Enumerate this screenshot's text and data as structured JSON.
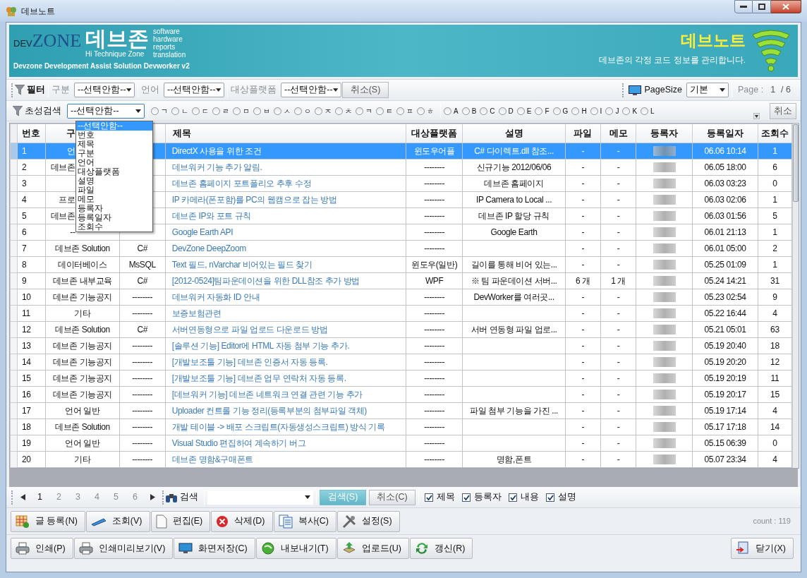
{
  "window": {
    "title": "데브노트"
  },
  "banner": {
    "logo_dev": "DEV",
    "logo_zone": "ZONE",
    "logo_name": "데브존",
    "logo_tagline": "Hi Technique Zone",
    "logo_words": [
      "software",
      "hardware",
      "reports",
      "translation"
    ],
    "subtitle": "Devzone Development Assist Solution Devworker v2",
    "title": "데브노트",
    "description": "데브존의 각정 코드 정보를 관리합니다."
  },
  "filter_bar": {
    "label": "필터",
    "filters": [
      {
        "label": "구분",
        "value": "--선택안함--"
      },
      {
        "label": "언어",
        "value": "--선택안함--"
      },
      {
        "label": "대상플랫폼",
        "value": "--선택안함--"
      }
    ],
    "cancel": "취소(S)",
    "page_size_label": "PageSize",
    "page_size": "기본",
    "page_label": "Page :",
    "page": "1",
    "page_total": "/ 6"
  },
  "initial_bar": {
    "label": "초성검색",
    "value": "--선택안함--",
    "letters": [
      {
        "label": "ㄱ",
        "selected": false
      },
      {
        "label": "ㄴ",
        "selected": false
      },
      {
        "label": "ㄷ",
        "selected": false
      },
      {
        "label": "ㄹ",
        "selected": false
      },
      {
        "label": "ㅁ",
        "selected": false
      },
      {
        "label": "ㅂ",
        "selected": false
      },
      {
        "label": "ㅅ",
        "selected": false
      },
      {
        "label": "ㅇ",
        "selected": false
      },
      {
        "label": "ㅈ",
        "selected": false
      },
      {
        "label": "ㅊ",
        "selected": false
      },
      {
        "label": "ㅋ",
        "selected": false
      },
      {
        "label": "ㅌ",
        "selected": false
      },
      {
        "label": "ㅍ",
        "selected": false
      },
      {
        "label": "ㅎ",
        "selected": false
      }
    ],
    "latin_letters": [
      {
        "label": "A",
        "selected": false
      },
      {
        "label": "B",
        "selected": false
      },
      {
        "label": "C",
        "selected": false
      },
      {
        "label": "D",
        "selected": false
      },
      {
        "label": "E",
        "selected": false
      },
      {
        "label": "F",
        "selected": false
      },
      {
        "label": "G",
        "selected": false
      },
      {
        "label": "H",
        "selected": false
      },
      {
        "label": "I",
        "selected": false
      },
      {
        "label": "J",
        "selected": false
      },
      {
        "label": "K",
        "selected": false
      },
      {
        "label": "L",
        "selected": false
      }
    ],
    "cancel": "취소"
  },
  "dropdown": {
    "open": true,
    "items": [
      {
        "label": "--선택안함--",
        "selected": true
      },
      {
        "label": "번호",
        "selected": false
      },
      {
        "label": "제목",
        "selected": false
      },
      {
        "label": "구분",
        "selected": false
      },
      {
        "label": "언어",
        "selected": false
      },
      {
        "label": "대상플랫폼",
        "selected": false
      },
      {
        "label": "설명",
        "selected": false
      },
      {
        "label": "파일",
        "selected": false
      },
      {
        "label": "메모",
        "selected": false
      },
      {
        "label": "등록자",
        "selected": false
      },
      {
        "label": "등록일자",
        "selected": false
      },
      {
        "label": "조회수",
        "selected": false
      }
    ]
  },
  "table": {
    "headers": {
      "no": "번호",
      "category": "구",
      "title": "제목",
      "platform": "대상플랫폼",
      "description": "설명",
      "file": "파일",
      "memo": "메모",
      "author": "등록자",
      "date": "등록일자",
      "views": "조회수"
    },
    "rows": [
      {
        "no": "1",
        "category": "언",
        "covered": true,
        "title": "DirectX 사용을 위한 조건",
        "platform": "윈도우어플",
        "description": "C# 다이렉트.dll 참조...",
        "file": "-",
        "memo": "-",
        "date": "06.06 10:14",
        "views": "1",
        "selected": true
      },
      {
        "no": "2",
        "category": "데브존",
        "covered": true,
        "title": "데브워커 기능 추가 알림.",
        "platform": "--------",
        "description": "신규기능 2012/06/06",
        "file": "-",
        "memo": "-",
        "date": "06.05 18:00",
        "views": "6",
        "selected": false
      },
      {
        "no": "3",
        "covered": true,
        "title": "데브존 홈페이지 포트폴리오 추후 수정",
        "platform": "--------",
        "description": "데브존 홈페이지",
        "file": "-",
        "memo": "-",
        "date": "06.03 03:23",
        "views": "0",
        "selected": false
      },
      {
        "no": "4",
        "category": "프로",
        "covered": true,
        "title": "IP 카메라(폰포함)를 PC의 웹캠으로 잡는 방법",
        "platform": "--------",
        "description": "IP Camera to Local ...",
        "file": "-",
        "memo": "-",
        "date": "06.03 02:06",
        "views": "1",
        "selected": false
      },
      {
        "no": "5",
        "category": "데브존",
        "covered": true,
        "title": "데브존 IP와 포트 규칙",
        "platform": "--------",
        "description": "데브존 IP 할당 규칙",
        "file": "-",
        "memo": "-",
        "date": "06.03 01:56",
        "views": "5",
        "selected": false
      },
      {
        "no": "6",
        "category": "--",
        "covered": true,
        "title": "Google Earth API",
        "platform": "--------",
        "description": "Google Earth",
        "file": "-",
        "memo": "-",
        "date": "06.01 21:13",
        "views": "1",
        "selected": false
      },
      {
        "no": "7",
        "category": "데브존 Solution",
        "language": "C#",
        "title": "DevZone DeepZoom",
        "platform": "--------",
        "file": "-",
        "memo": "-",
        "date": "06.01 05:00",
        "views": "2",
        "selected": false
      },
      {
        "no": "8",
        "category": "데이터베이스",
        "language": "MsSQL",
        "title": "Text 필드, nVarchar 비어있는 필드 찾기",
        "platform": "윈도우(일반)",
        "description": "길이를 통해 비어 있는...",
        "file": "-",
        "memo": "-",
        "date": "05.25 01:09",
        "views": "1",
        "selected": false
      },
      {
        "no": "9",
        "category": "데브존 내부교육",
        "language": "C#",
        "title": "[2012-0524]팀파운데이션을 위한 DLL참조 추가 방법",
        "platform": "WPF",
        "description": "※ 팀 파운데이션 서버...",
        "file": "6 개",
        "memo": "1 개",
        "date": "05.24 14:21",
        "views": "31",
        "selected": false
      },
      {
        "no": "10",
        "category": "데브존 기능공지",
        "language": "--------",
        "title": "데브워커 자동화 ID 안내",
        "platform": "--------",
        "description": "DevWorker를 여러곳...",
        "file": "-",
        "memo": "-",
        "date": "05.23 02:54",
        "views": "9",
        "selected": false
      },
      {
        "no": "11",
        "category": "기타",
        "language": "--------",
        "title": "보증보험관련",
        "platform": "--------",
        "file": "-",
        "memo": "-",
        "date": "05.22 16:44",
        "views": "4",
        "selected": false
      },
      {
        "no": "12",
        "category": "데브존 Solution",
        "language": "C#",
        "title": "서버연동형으로 파일 업로드 다운로드 방법",
        "platform": "--------",
        "description": "서버 연동형 파일 업로...",
        "file": "-",
        "memo": "-",
        "date": "05.21 05:01",
        "views": "63",
        "selected": false
      },
      {
        "no": "13",
        "category": "데브존 기능공지",
        "language": "--------",
        "title": "[솔루션 기능] Editor에 HTML 자동 첨부 기능 추가.",
        "platform": "--------",
        "file": "-",
        "memo": "-",
        "date": "05.19 20:40",
        "views": "18",
        "selected": false
      },
      {
        "no": "14",
        "category": "데브존 기능공지",
        "language": "--------",
        "title": "[개발보조툴 기능] 데브존 인증서 자동 등록.",
        "platform": "--------",
        "file": "-",
        "memo": "-",
        "date": "05.19 20:20",
        "views": "12",
        "selected": false
      },
      {
        "no": "15",
        "category": "데브존 기능공지",
        "language": "--------",
        "title": "[개발보조툴 기능] 데브존 업무 연락처 자동 등록.",
        "platform": "--------",
        "file": "-",
        "memo": "-",
        "date": "05.19 20:19",
        "views": "11",
        "selected": false
      },
      {
        "no": "16",
        "category": "데브존 기능공지",
        "language": "--------",
        "title": "[데브워커 기능] 데브존 네트워크 연결 관련 기능 추가",
        "platform": "--------",
        "file": "-",
        "memo": "-",
        "date": "05.19 20:17",
        "views": "15",
        "selected": false
      },
      {
        "no": "17",
        "category": "언어 일반",
        "language": "--------",
        "title": "Uploader 컨트롤 기능 정리(등록부분의 첨부파일 객체)",
        "platform": "--------",
        "description": "파일 첨부 기능을 가진 ...",
        "file": "-",
        "memo": "-",
        "date": "05.19 17:14",
        "views": "4",
        "selected": false
      },
      {
        "no": "18",
        "category": "데브존 Solution",
        "language": "--------",
        "title": "개발 테이블 -> 배포 스크립트(자동생성스크립트) 방식 기록",
        "platform": "--------",
        "file": "-",
        "memo": "-",
        "date": "05.17 17:18",
        "views": "14",
        "selected": false
      },
      {
        "no": "19",
        "category": "언어 일반",
        "language": "--------",
        "title": "Visual Studio 편집하여 계속하기 버그",
        "platform": "--------",
        "file": "-",
        "memo": "-",
        "date": "05.15 06:39",
        "views": "0",
        "selected": false
      },
      {
        "no": "20",
        "category": "기타",
        "language": "--------",
        "title": "데브존 명함&구매폰트",
        "platform": "--------",
        "description": "명함,폰트",
        "file": "-",
        "memo": "-",
        "date": "05.07 23:34",
        "views": "4",
        "selected": false
      }
    ]
  },
  "search_bar": {
    "pages": [
      {
        "label": "1",
        "selected": true
      },
      {
        "label": "2",
        "selected": false
      },
      {
        "label": "3",
        "selected": false
      },
      {
        "label": "4",
        "selected": false
      },
      {
        "label": "5",
        "selected": false
      },
      {
        "label": "6",
        "selected": false
      }
    ],
    "search_label": "검색",
    "search_button": "검색(S)",
    "cancel_button": "취소(C)",
    "options": [
      {
        "label": "제목",
        "checked": true
      },
      {
        "label": "등록자",
        "checked": true
      },
      {
        "label": "내용",
        "checked": true
      },
      {
        "label": "설명",
        "checked": true
      }
    ]
  },
  "actions": [
    {
      "label": "글 등록(N)",
      "kind": "grid"
    },
    {
      "label": "조회(V)",
      "kind": "pen"
    },
    {
      "label": "편집(E)",
      "kind": "page"
    },
    {
      "label": "삭제(D)",
      "kind": "delete"
    },
    {
      "label": "복사(C)",
      "kind": "copy"
    },
    {
      "label": "설정(S)",
      "kind": "tools"
    }
  ],
  "count": "count : 119",
  "output_actions": [
    {
      "label": "인쇄(P)",
      "kind": "printer"
    },
    {
      "label": "인쇄미리보기(V)",
      "kind": "printer"
    },
    {
      "label": "화면저장(C)",
      "kind": "monitor"
    },
    {
      "label": "내보내기(T)",
      "kind": "globe"
    },
    {
      "label": "업로드(U)",
      "kind": "upload"
    },
    {
      "label": "갱신(R)",
      "kind": "refresh"
    }
  ],
  "close_button": {
    "label": "닫기(X)",
    "kind": "exit"
  }
}
